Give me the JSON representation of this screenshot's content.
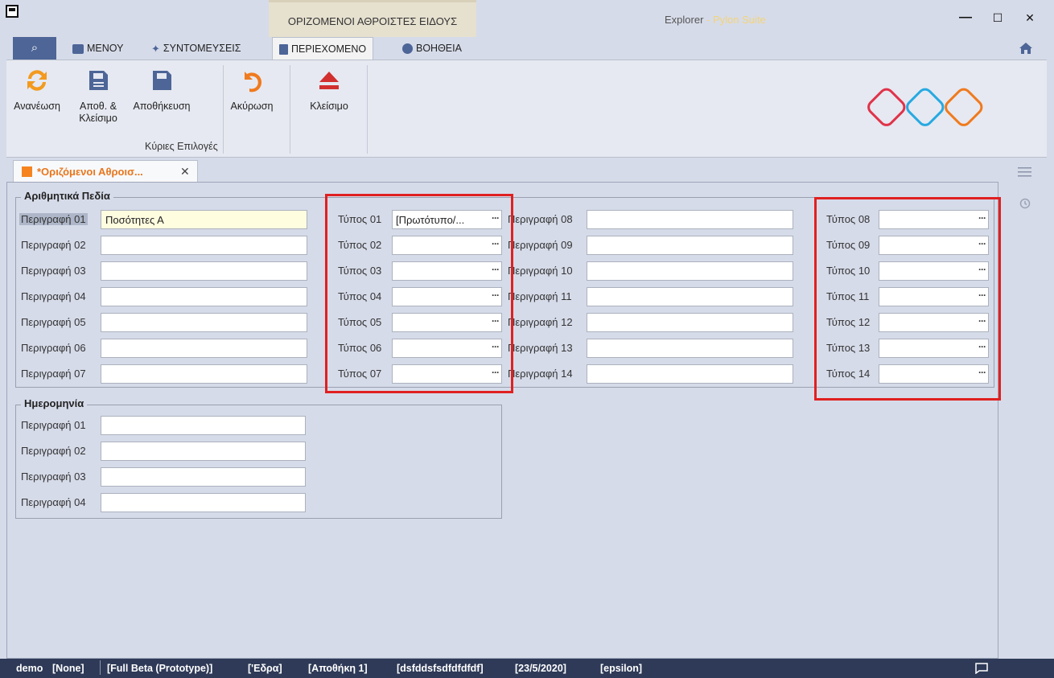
{
  "window": {
    "context_tab": "ΟΡΙΖΟΜΕΝΟΙ ΑΘΡΟΙΣΤΕΣ ΕΙΔΟΥΣ",
    "title": "Explorer",
    "title_suffix": " - Pylon Suite",
    "min": "—",
    "max": "☐",
    "close": "✕"
  },
  "ribbon_tabs": {
    "search": "⌕",
    "menu": "ΜΕΝΟΥ",
    "shortcuts": "ΣΥΝΤΟΜΕΥΣΕΙΣ",
    "content": "ΠΕΡΙΕΧΟΜΕΝΟ",
    "help": "ΒΟΗΘΕΙΑ"
  },
  "ribbon": {
    "refresh": "Ανανέωση",
    "save_close_1": "Αποθ. &",
    "save_close_2": "Κλείσιμο",
    "save": "Αποθήκευση",
    "cancel": "Ακύρωση",
    "close": "Κλείσιμο",
    "group_label": "Κύριες Επιλογές",
    "colors": {
      "refresh": "#f39a1e",
      "save": "#4d6597",
      "cancel": "#f07a1e",
      "close": "#d22f2f"
    }
  },
  "doc_tab": {
    "label": "*Οριζόμενοι Αθροισ...",
    "close": "✕"
  },
  "numeric_group": {
    "title": "Αριθμητικά Πεδία",
    "descriptions_left": [
      {
        "label": "Περιγραφή 01",
        "value": "Ποσότητες Α"
      },
      {
        "label": "Περιγραφή 02",
        "value": ""
      },
      {
        "label": "Περιγραφή 03",
        "value": ""
      },
      {
        "label": "Περιγραφή 04",
        "value": ""
      },
      {
        "label": "Περιγραφή 05",
        "value": ""
      },
      {
        "label": "Περιγραφή 06",
        "value": ""
      },
      {
        "label": "Περιγραφή 07",
        "value": ""
      }
    ],
    "types_left": [
      {
        "label": "Τύπος 01",
        "value": "[Πρωτότυπο/..."
      },
      {
        "label": "Τύπος 02",
        "value": ""
      },
      {
        "label": "Τύπος 03",
        "value": ""
      },
      {
        "label": "Τύπος 04",
        "value": ""
      },
      {
        "label": "Τύπος 05",
        "value": ""
      },
      {
        "label": "Τύπος 06",
        "value": ""
      },
      {
        "label": "Τύπος 07",
        "value": ""
      }
    ],
    "descriptions_right": [
      {
        "label": "Περιγραφή 08",
        "value": ""
      },
      {
        "label": "Περιγραφή 09",
        "value": ""
      },
      {
        "label": "Περιγραφή 10",
        "value": ""
      },
      {
        "label": "Περιγραφή 11",
        "value": ""
      },
      {
        "label": "Περιγραφή 12",
        "value": ""
      },
      {
        "label": "Περιγραφή 13",
        "value": ""
      },
      {
        "label": "Περιγραφή 14",
        "value": ""
      }
    ],
    "types_right": [
      {
        "label": "Τύπος 08",
        "value": ""
      },
      {
        "label": "Τύπος 09",
        "value": ""
      },
      {
        "label": "Τύπος 10",
        "value": ""
      },
      {
        "label": "Τύπος 11",
        "value": ""
      },
      {
        "label": "Τύπος 12",
        "value": ""
      },
      {
        "label": "Τύπος 13",
        "value": ""
      },
      {
        "label": "Τύπος 14",
        "value": ""
      }
    ],
    "dropdown_button": "···"
  },
  "date_group": {
    "title": "Ημερομηνία",
    "fields": [
      {
        "label": "Περιγραφή 01",
        "value": ""
      },
      {
        "label": "Περιγραφή 02",
        "value": ""
      },
      {
        "label": "Περιγραφή 03",
        "value": ""
      },
      {
        "label": "Περιγραφή 04",
        "value": ""
      }
    ]
  },
  "status_bar": {
    "user": "demo",
    "none": "[None]",
    "edition": "[Full Beta (Prototype)]",
    "branch": "['Εδρα]",
    "warehouse": "[Αποθήκη 1]",
    "company": "[dsfddsfsdfdfdfdf]",
    "date": "[23/5/2020]",
    "db": "[epsilon]"
  },
  "colors": {
    "accent": "#e8761c",
    "highlight_box": "#e02020",
    "status_bg": "#2e3a57",
    "selected_tab": "#4d6597"
  }
}
